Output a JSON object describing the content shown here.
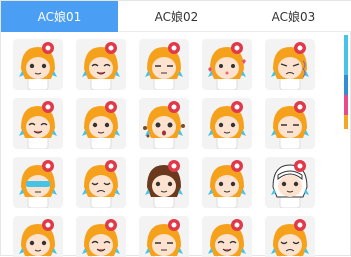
{
  "tabs": [
    {
      "label": "AC娘01",
      "active": true
    },
    {
      "label": "AC娘02",
      "active": false
    },
    {
      "label": "AC娘03",
      "active": false
    }
  ],
  "colors": {
    "accent": "#4a9ff5",
    "hair": "#f6a11b",
    "ribbon": "#e0394a",
    "strip": [
      "#45c4e6",
      "#2f8fd6",
      "#e84b8a",
      "#f5a623"
    ]
  },
  "stickers": [
    {
      "name": "sticker-neutral",
      "expr": "neutral"
    },
    {
      "name": "sticker-smile-shirt",
      "expr": "smile"
    },
    {
      "name": "sticker-squint",
      "expr": "squint"
    },
    {
      "name": "sticker-love",
      "expr": "love"
    },
    {
      "name": "sticker-angry",
      "expr": "angry"
    },
    {
      "name": "sticker-happy",
      "expr": "happy"
    },
    {
      "name": "sticker-messy",
      "expr": "messy"
    },
    {
      "name": "sticker-shock-dots",
      "expr": "shock"
    },
    {
      "name": "sticker-thinking",
      "expr": "think"
    },
    {
      "name": "sticker-sleepy",
      "expr": "sleepy"
    },
    {
      "name": "sticker-glasses",
      "expr": "glasses"
    },
    {
      "name": "sticker-sad",
      "expr": "sad"
    },
    {
      "name": "sticker-dark-brown",
      "expr": "dark"
    },
    {
      "name": "sticker-sneeze",
      "expr": "sneeze"
    },
    {
      "name": "sticker-sketch",
      "expr": "sketch"
    },
    {
      "name": "sticker-peek-1",
      "expr": "neutral"
    },
    {
      "name": "sticker-peek-2",
      "expr": "happy"
    },
    {
      "name": "sticker-peek-3",
      "expr": "squint"
    },
    {
      "name": "sticker-peek-4",
      "expr": "smile"
    },
    {
      "name": "sticker-peek-5",
      "expr": "sad"
    }
  ]
}
